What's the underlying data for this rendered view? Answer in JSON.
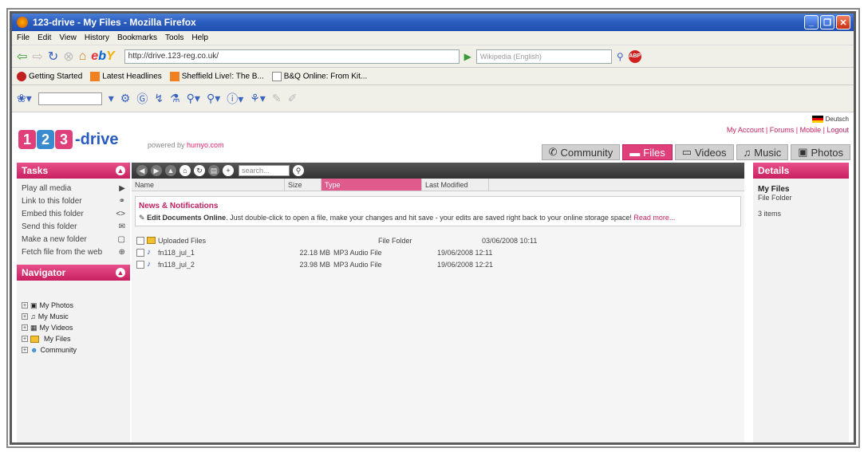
{
  "window": {
    "title": "123-drive - My Files - Mozilla Firefox"
  },
  "menu": [
    "File",
    "Edit",
    "View",
    "History",
    "Bookmarks",
    "Tools",
    "Help"
  ],
  "nav": {
    "url": "http://drive.123-reg.co.uk/",
    "search_placeholder": "Wikipedia (English)",
    "ebay": "ebY"
  },
  "bookmarks": [
    "Getting Started",
    "Latest Headlines",
    "Sheffield Live!: The B...",
    "B&Q Online: From Kit..."
  ],
  "site": {
    "logo_text": "-drive",
    "logo_digits": [
      "1",
      "2",
      "3"
    ],
    "powered_prefix": "powered by",
    "powered_brand": "humyo.com",
    "lang": "Deutsch",
    "toplinks": "My Account | Forums | Mobile | Logout",
    "tabs": [
      {
        "label": "Community",
        "icon": "community-icon"
      },
      {
        "label": "Files",
        "icon": "files-icon"
      },
      {
        "label": "Videos",
        "icon": "videos-icon"
      },
      {
        "label": "Music",
        "icon": "music-icon"
      },
      {
        "label": "Photos",
        "icon": "photos-icon"
      }
    ]
  },
  "tasks": {
    "title": "Tasks",
    "items": [
      {
        "label": "Play all media",
        "icon": "play-icon"
      },
      {
        "label": "Link to this folder",
        "icon": "link-icon"
      },
      {
        "label": "Embed this folder",
        "icon": "embed-icon"
      },
      {
        "label": "Send this folder",
        "icon": "send-icon"
      },
      {
        "label": "Make a new folder",
        "icon": "new-folder-icon"
      },
      {
        "label": "Fetch file from the web",
        "icon": "web-icon"
      }
    ]
  },
  "navigator": {
    "title": "Navigator",
    "items": [
      "My Photos",
      "My Music",
      "My Videos",
      "My Files",
      "Community"
    ]
  },
  "center": {
    "search_placeholder": "search...",
    "columns": [
      "Name",
      "Size",
      "Type",
      "Last Modified"
    ],
    "news_title": "News & Notifications",
    "news_bold": "Edit Documents Online",
    "news_text": ". Just double-click to open a file, make your changes and hit save - your edits are saved right back to your online storage space!",
    "news_link": "Read more...",
    "files": [
      {
        "name": "Uploaded Files",
        "size": "",
        "type": "File Folder",
        "modified": "03/06/2008 10:11",
        "kind": "folder"
      },
      {
        "name": "fn118_jul_1",
        "size": "22.18 MB",
        "type": "MP3 Audio File",
        "modified": "19/06/2008 12:11",
        "kind": "mp3"
      },
      {
        "name": "fn118_jul_2",
        "size": "23.98 MB",
        "type": "MP3 Audio File",
        "modified": "19/06/2008 12:21",
        "kind": "mp3"
      }
    ]
  },
  "details": {
    "title": "Details",
    "name": "My Files",
    "type": "File Folder",
    "count": "3 items"
  }
}
